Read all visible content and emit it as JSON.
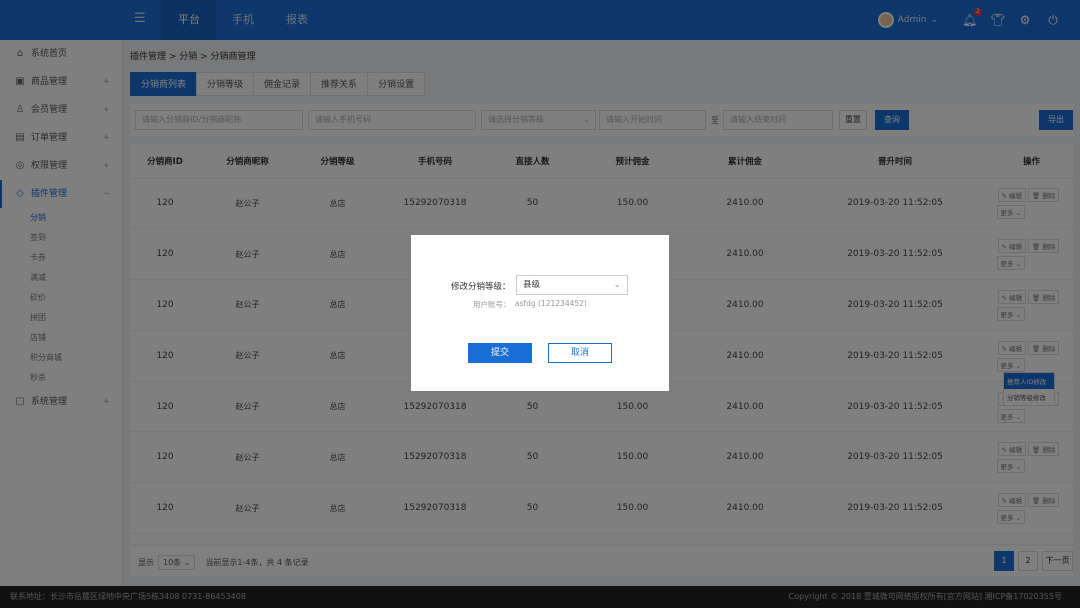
{
  "topbar": {
    "nav": [
      "平台",
      "手机",
      "报表"
    ],
    "active_nav": 0,
    "user": "Admin",
    "notification_count": "2"
  },
  "sidebar": {
    "items": [
      {
        "label": "系统首页",
        "icon": "home-icon"
      },
      {
        "label": "商品管理",
        "icon": "shop-icon"
      },
      {
        "label": "会员管理",
        "icon": "users-icon"
      },
      {
        "label": "订单管理",
        "icon": "order-icon"
      },
      {
        "label": "权限管理",
        "icon": "shield-icon"
      },
      {
        "label": "插件管理",
        "icon": "plugin-icon"
      }
    ],
    "subitems": [
      "分销",
      "签到",
      "卡券",
      "满减",
      "砍价",
      "拼团",
      "店铺",
      "积分商城",
      "秒杀"
    ],
    "last_item": {
      "label": "系统管理",
      "icon": "system-icon"
    }
  },
  "breadcrumb": "插件管理 > 分销 > 分销商管理",
  "tabs": [
    "分销商列表",
    "分销等级",
    "佣金记录",
    "推荐关系",
    "分销设置"
  ],
  "filters": {
    "id_placeholder": "请输入分销商ID/分销商昵称",
    "phone_placeholder": "请输入手机号码",
    "level_placeholder": "请选择分销等级",
    "start_placeholder": "请输入开始时间",
    "to": "至",
    "end_placeholder": "请输入结束时间",
    "reset": "重置",
    "query": "查询",
    "export": "导出"
  },
  "table": {
    "headers": [
      "分销商ID",
      "分销商昵称",
      "分销等级",
      "手机号码",
      "直接人数",
      "预计佣金",
      "累计佣金",
      "晋升时间",
      "操作"
    ],
    "rows": [
      [
        "120",
        "赵公子",
        "总店",
        "15292070318",
        "50",
        "150.00",
        "2410.00",
        "2019-03-20 11:52:05"
      ],
      [
        "120",
        "赵公子",
        "总店",
        "",
        "",
        "",
        "2410.00",
        "2019-03-20 11:52:05"
      ],
      [
        "120",
        "赵公子",
        "总店",
        "",
        "",
        "",
        "2410.00",
        "2019-03-20 11:52:05"
      ],
      [
        "120",
        "赵公子",
        "总店",
        "",
        "",
        "",
        "2410.00",
        "2019-03-20 11:52:05"
      ],
      [
        "120",
        "赵公子",
        "总店",
        "15292070318",
        "50",
        "150.00",
        "2410.00",
        "2019-03-20 11:52:05"
      ],
      [
        "120",
        "赵公子",
        "总店",
        "15292070318",
        "50",
        "150.00",
        "2410.00",
        "2019-03-20 11:52:05"
      ],
      [
        "120",
        "赵公子",
        "总店",
        "15292070318",
        "50",
        "150.00",
        "2410.00",
        "2019-03-20 11:52:05"
      ]
    ],
    "op_edit": "编辑",
    "op_delete": "删除",
    "op_more": "更多",
    "dropdown": [
      "推荐人ID修改",
      "分销等级修改"
    ]
  },
  "pager": {
    "show": "显示",
    "per_page": "10条",
    "summary": "当前显示1-4条，共 4 条记录",
    "pages": [
      "1",
      "2"
    ],
    "next": "下一页"
  },
  "footer": {
    "left": "联系地址：长沙市岳麓区绿地中央广场5栋3408    0731-86453408",
    "right": "Copyright © 2018 壹城微可网络版权所有[官方网站]  湘ICP备17020355号"
  },
  "modal": {
    "label": "修改分销等级：",
    "selected": "县级",
    "user_label": "用户账号：",
    "user_value": "asfdg (121234452)",
    "submit": "提交",
    "cancel": "取消"
  }
}
